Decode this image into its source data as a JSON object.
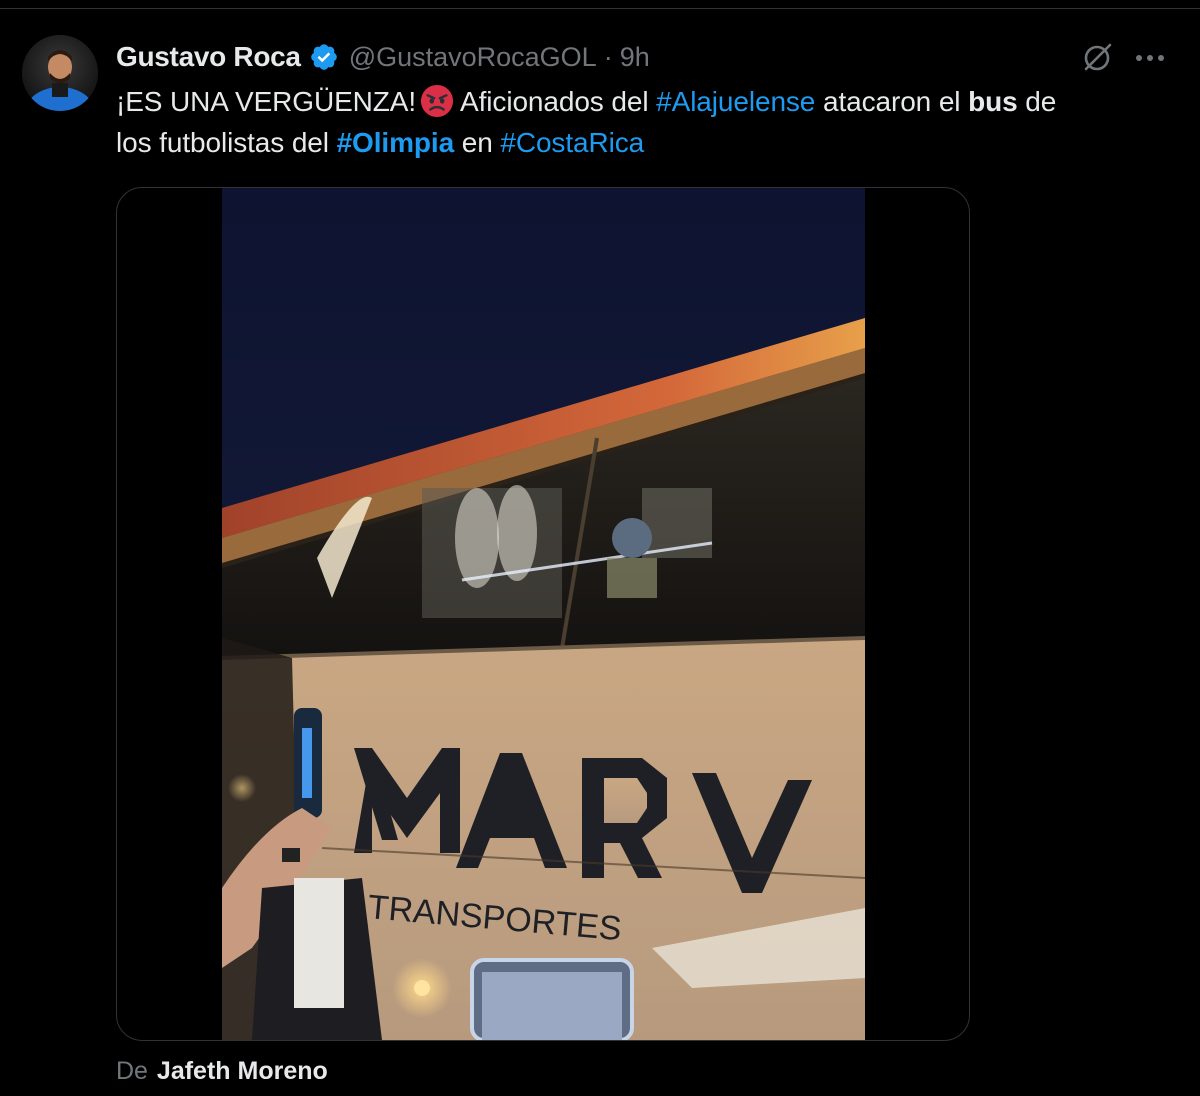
{
  "tweet": {
    "author_name": "Gustavo Roca",
    "handle": "@GustavoRocaGOL",
    "separator": "·",
    "time": "9h",
    "text_line1": {
      "part1": "¡ES UNA VERGÜENZA!",
      "emoji": "angry-face-emoji",
      "part2": "Aficionados del ",
      "hashtag1": "#Alajuelense",
      "part3": " atacaron el ",
      "bold1": "bus",
      "part4": " de"
    },
    "text_line2": {
      "part1": "los futbolistas del ",
      "hashtag2": "#Olimpia",
      "part2": " en ",
      "hashtag3": "#CostaRica"
    },
    "media": {
      "bus_brand": "MARV",
      "bus_subtext": "TRANSPORTES"
    },
    "credit": {
      "prefix": "De",
      "name": "Jafeth Moreno"
    }
  },
  "colors": {
    "background": "#000000",
    "text": "#e7e9ea",
    "secondary": "#71767b",
    "link": "#1d9bf0",
    "verified": "#1d9bf0",
    "border": "#2f3336"
  },
  "icons": {
    "verified": "verified-badge-icon",
    "grok": "grok-icon",
    "more": "more-dots-icon"
  }
}
